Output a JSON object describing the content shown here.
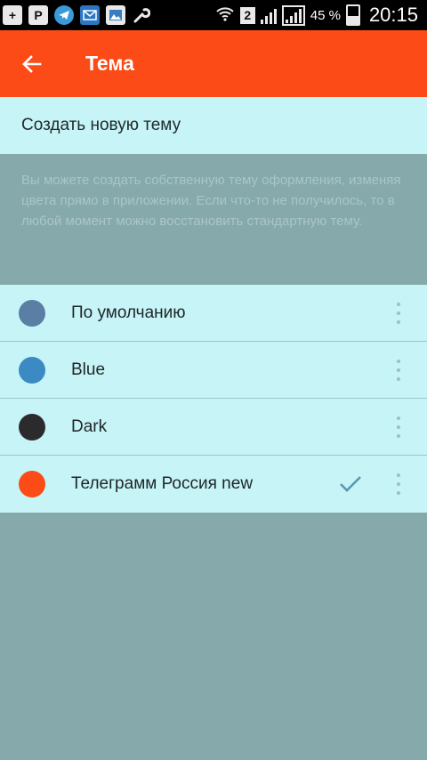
{
  "status_bar": {
    "icons": [
      "plus-icon",
      "p-app-icon",
      "telegram-icon",
      "mail-app-icon",
      "image-app-icon",
      "wrench-icon"
    ],
    "sim_slot": "2",
    "battery_percent": "45 %",
    "time": "20:15"
  },
  "toolbar": {
    "title": "Тема",
    "accent_color": "#fc4b16"
  },
  "create_theme": {
    "label": "Создать новую тему"
  },
  "info": {
    "text": "Вы можете создать собственную тему оформления, изменяя цвета прямо в приложении. Если что-то не получилось, то в любой момент можно восстановить стандартную тему."
  },
  "themes": [
    {
      "name": "По умолчанию",
      "color": "#5b7ea4",
      "selected": false
    },
    {
      "name": "Blue",
      "color": "#3b8ac4",
      "selected": false
    },
    {
      "name": "Dark",
      "color": "#2b2b2e",
      "selected": false
    },
    {
      "name": "Телеграмм Россия new",
      "color": "#fc4b16",
      "selected": true
    }
  ],
  "colors": {
    "list_background": "#c6f4f7",
    "screen_background": "#86a9ab",
    "check_color": "#5a98b3"
  }
}
